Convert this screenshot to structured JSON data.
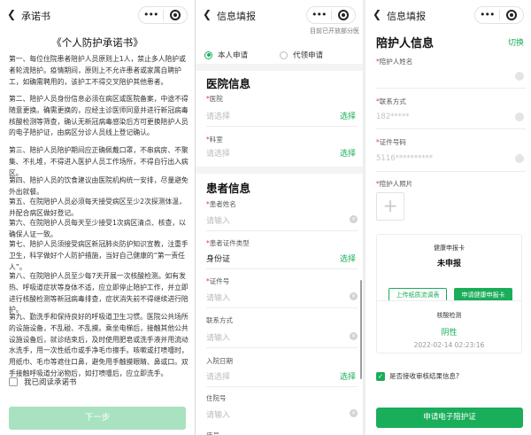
{
  "panel1": {
    "title": "承诺书",
    "doc_title": "《个人防护承诺书》",
    "paragraphs": [
      "第一、每位住院患者陪护人员原则上1人，禁止多人陪护或者轮流陪护。疫情期间，原则上不允许患者或家属自聘护工，如确需聘用的，该护工不得交叉陪护其他患者。",
      "第二、陪护人员身份信息必须在病区或医院备案，中途不得随意更换。确需更换的，应经主诊医师同意并进行新冠病毒核酸检测等筛查，确认无新冠病毒感染后方可更换陪护人员的电子陪护证，由病区分诊人员线上登记确认。",
      "第三、陪护人员陪护期间应正确佩戴口罩，不串病房、不聚集、不扎堆，不得进入医护人员工作场所，不得自行出入病区。",
      "第四、陪护人员的饮食建议由医院机构统一安排，尽量避免外出就餐。",
      "第五、在院陪护人员必须每天接受病区至少2次探测体温，并配合病区做好登记。",
      "第六、在院陪护人员每天至少接受1次病区清点、核查，以确保人证一致。",
      "第七、陪护人员须接受病区新冠肺炎防护知识宣教，注重手卫生，科学做好个人防护措施，当好自己健康的“第一责任人”。",
      "第八、在院陪护人员至少每7天开展一次核酸检测。如有发热、呼吸道症状等身体不适，应立即停止陪护工作，并立即进行核酸检测等新冠病毒排查，症状消失前不得继续进行陪护。",
      "第九、勤洗手和保持良好的呼吸道卫生习惯。医院公共场所的设施设备，不乱碰、不乱摸。乘坐电梯后，接触其他公共设施设备后，就诊结束后，及时使用肥皂或洗手液并用流动水洗手，用一次性纸巾或手净毛巾擦手。咳嗽或打喷嚏时，用纸巾、毛巾等遮住口鼻，避免用手触摸眼睛、鼻或口。双手接触呼吸道分泌物后，如打喷嚏后，应立即洗手。"
    ],
    "checkbox_label": "我已阅读承诺书",
    "next_button": "下一步"
  },
  "panel2": {
    "title": "信息填报",
    "notice": "目前已开放部分医",
    "radio_self": "本人申请",
    "radio_proxy": "代领申请",
    "hospital_section": "医院信息",
    "hospital_label": "医院",
    "hospital_placeholder": "请选择",
    "ward_label": "科室",
    "ward_placeholder": "请选择",
    "pick_label": "选择",
    "patient_section": "患者信息",
    "patient_name_label": "患者姓名",
    "patient_name_placeholder": "请输入",
    "id_type_label": "患者证件类型",
    "id_type_value": "身份证",
    "id_no_label": "证件号",
    "id_no_placeholder": "请输入",
    "contact_label": "联系方式",
    "contact_placeholder": "请输入",
    "admit_date_label": "入院日期",
    "admit_date_placeholder": "请选择",
    "bed_no_label": "住院号",
    "bed_no_placeholder": "请输入",
    "cut_label": "床号"
  },
  "panel3": {
    "title": "信息填报",
    "section_title": "陪护人信息",
    "switch_label": "切换",
    "name_label": "陪护人姓名",
    "name_value": "",
    "contact_label": "联系方式",
    "contact_value": "182*****",
    "id_label": "证件号码",
    "id_value": "5116**********",
    "photo_label": "陪护人照片",
    "health_card": {
      "title": "健康申报卡",
      "status": "未申报",
      "btn_paper": "上传纸质流调表",
      "btn_apply": "申请健康申报卡"
    },
    "nucleic": {
      "title": "核酸检测",
      "result": "阴性",
      "time": "2022-02-14 02:23:16"
    },
    "accept_label": "是否接收审核结果信息?",
    "apply_button": "申请电子陪护证"
  },
  "colors": {
    "accent": "#1aad5a",
    "accent_light": "#a8e2c0"
  }
}
